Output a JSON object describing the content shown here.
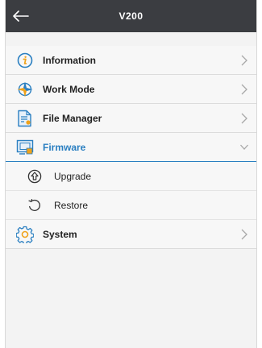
{
  "header": {
    "title": "V200",
    "back_icon": "back-arrow-icon"
  },
  "menu": {
    "information": {
      "label": "Information",
      "icon": "info-icon"
    },
    "work_mode": {
      "label": "Work Mode",
      "icon": "compass-icon"
    },
    "file_manager": {
      "label": "File Manager",
      "icon": "file-manager-icon"
    },
    "firmware": {
      "label": "Firmware",
      "icon": "firmware-icon",
      "expanded": true,
      "children": {
        "upgrade": {
          "label": "Upgrade",
          "icon": "upgrade-icon"
        },
        "restore": {
          "label": "Restore",
          "icon": "restore-icon"
        }
      }
    },
    "system": {
      "label": "System",
      "icon": "gear-icon"
    }
  },
  "colors": {
    "accent": "#2a7fc1",
    "topbar": "#3b3d41",
    "background": "#f3f3f3"
  }
}
